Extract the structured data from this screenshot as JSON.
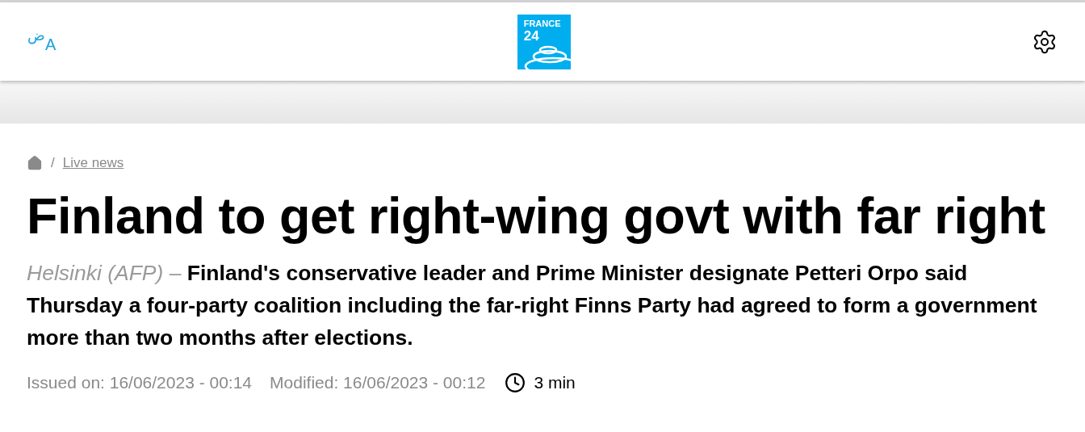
{
  "header": {
    "language_switch": {
      "arabic": "ض",
      "latin": "A"
    },
    "logo": {
      "line_1": "FRANCE",
      "line_2": "24"
    }
  },
  "breadcrumb": {
    "separator": "/",
    "items": [
      {
        "label": "Live news"
      }
    ]
  },
  "article": {
    "title": "Finland to get right-wing govt with far right",
    "lead": "*Helsinki (AFP) –* Finland's conservative leader and Prime Minister designate Petteri Orpo said Thursday a four-party coalition including the far-right Finns Party had agreed to form a government more than two months after elections.",
    "issued": "Issued on: 16/06/2023 - 00:14",
    "modified": "Modified: 16/06/2023 - 00:12",
    "reading_time": "3 min"
  }
}
